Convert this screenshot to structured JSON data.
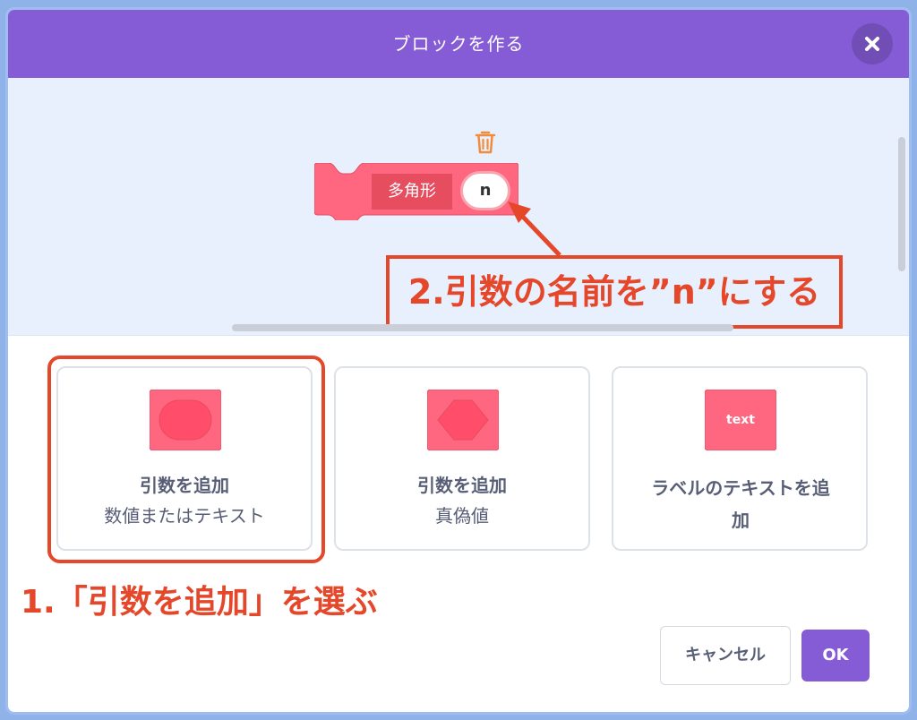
{
  "modal": {
    "title": "ブロックを作る",
    "close_icon": "close-icon"
  },
  "workspace": {
    "block_label": "多角形",
    "block_arg": "n",
    "colors": {
      "block": "#ff6680",
      "label_bg": "#e64d5e",
      "trash": "#f28b3c"
    }
  },
  "annotations": {
    "note2": "2.引数の名前を”n”にする",
    "note1": "1.「引数を追加」を選ぶ",
    "color": "#e5472a"
  },
  "options": [
    {
      "line1": "引数を追加",
      "line2": "数値またはテキスト"
    },
    {
      "line1": "引数を追加",
      "line2": "真偽値"
    },
    {
      "icon_text": "text",
      "line1": "ラベルのテキストを追",
      "line2": "加"
    }
  ],
  "buttons": {
    "cancel": "キャンセル",
    "ok": "OK"
  },
  "theme": {
    "header": "#855cd6",
    "workspace_bg": "#e8f0fe"
  }
}
